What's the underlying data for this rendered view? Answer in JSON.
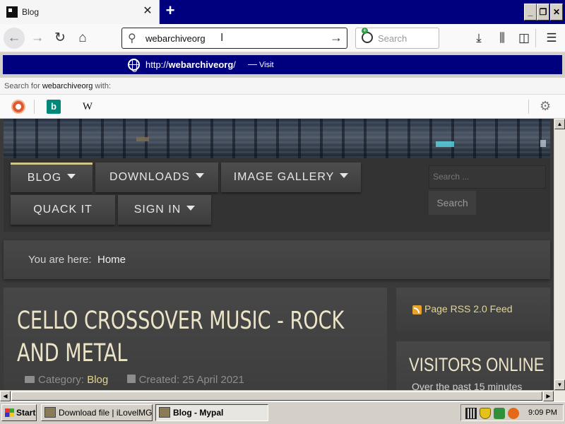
{
  "browser": {
    "tab": {
      "title": "Blog",
      "close_glyph": "✕"
    },
    "new_tab_glyph": "+",
    "window_buttons": {
      "minimize": "_",
      "restore": "❐",
      "close": "✕"
    },
    "nav": {
      "back_glyph": "←",
      "forward_glyph": "→",
      "reload_glyph": "↻",
      "home_glyph": "⌂",
      "go_glyph": "→"
    },
    "url": {
      "value": "webarchiveorg",
      "caret_glyph": "I"
    },
    "search": {
      "placeholder": "Search"
    },
    "toolbar_icons": {
      "download": "⤓",
      "library": "⫼",
      "sidebar": "◫",
      "menu": "☰"
    },
    "suggestion": {
      "url_prefix": "http://",
      "url_bold": "webarchiveorg",
      "url_suffix": "/",
      "separator": "—",
      "action": "Visit"
    },
    "search_for": {
      "prefix": "Search for ",
      "term": "webarchiveorg",
      "suffix": " with:"
    },
    "engines": {
      "bing_glyph": "b",
      "wikipedia_glyph": "W",
      "settings_glyph": "⚙"
    }
  },
  "page": {
    "menu": [
      {
        "label": "BLOG",
        "has_dropdown": true,
        "active": true
      },
      {
        "label": "DOWNLOADS",
        "has_dropdown": true
      },
      {
        "label": "IMAGE GALLERY",
        "has_dropdown": true
      },
      {
        "label": "QUACK IT",
        "has_dropdown": false
      },
      {
        "label": "SIGN IN",
        "has_dropdown": true
      }
    ],
    "site_search": {
      "placeholder": "Search ...",
      "button": "Search"
    },
    "breadcrumb": {
      "label": "You are here:",
      "current": "Home"
    },
    "article": {
      "title": "CELLO CROSSOVER MUSIC - ROCK AND METAL",
      "category_label": "Category:",
      "category": "Blog",
      "created": "Created: 25 April 2021"
    },
    "rss": {
      "label": "Page RSS 2.0 Feed"
    },
    "visitors": {
      "title": "VISITORS ONLINE",
      "subtitle": "Over the past 15 minutes"
    },
    "accent_color": "#e5d58c"
  },
  "taskbar": {
    "start": "Start",
    "tasks": [
      {
        "label": "Download file | iLovelMG ..."
      },
      {
        "label": "Blog - Mypal"
      }
    ],
    "clock": "9:09 PM"
  },
  "scroll": {
    "up": "▲",
    "down": "▼",
    "left": "◀",
    "right": "▶"
  }
}
